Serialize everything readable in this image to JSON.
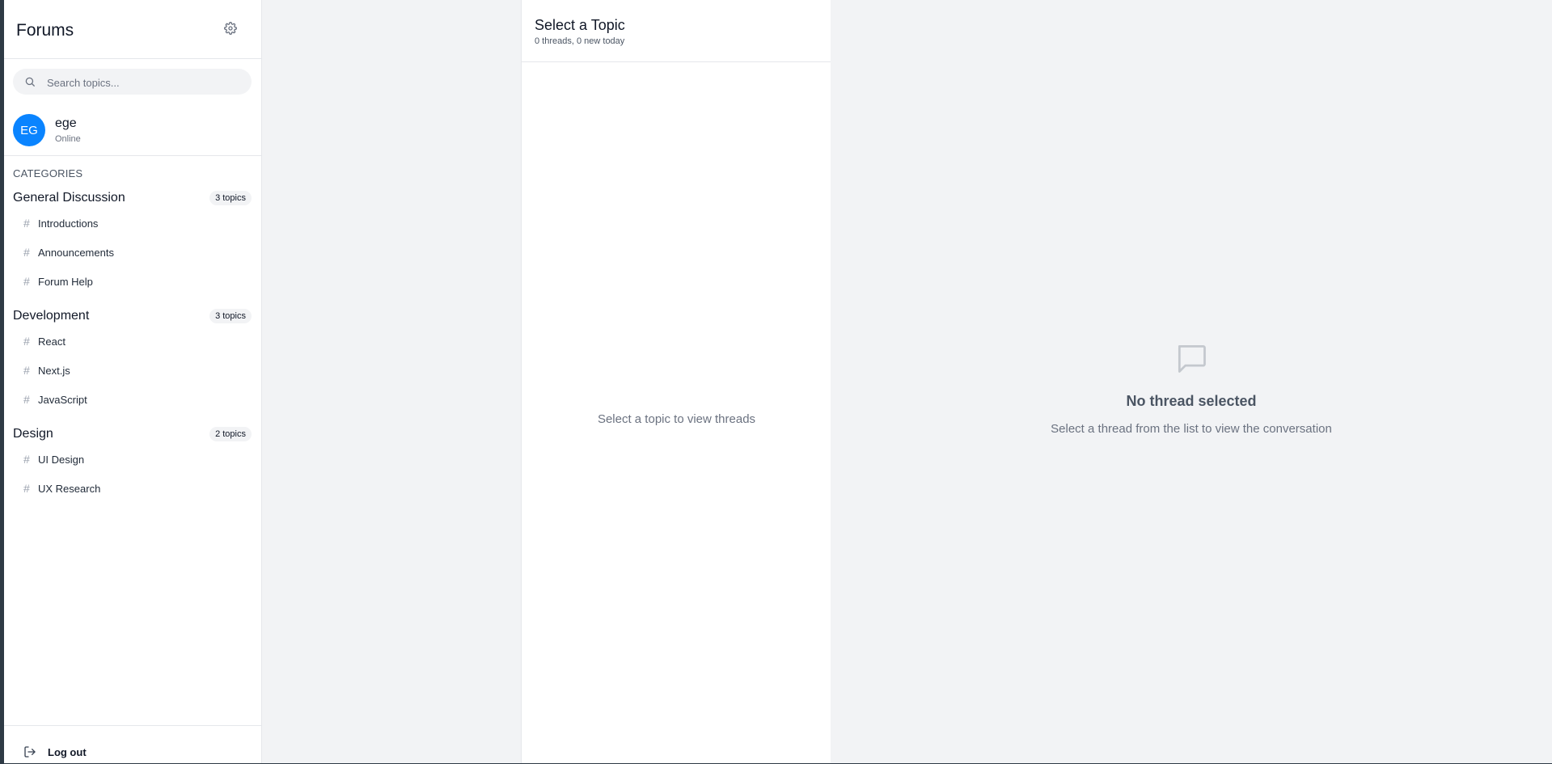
{
  "sidebar": {
    "title": "Forums",
    "search": {
      "placeholder": "Search topics..."
    },
    "user": {
      "initials": "EG",
      "name": "ege",
      "status": "Online"
    },
    "categories_heading": "CATEGORIES",
    "categories": [
      {
        "name": "General Discussion",
        "badge": "3 topics",
        "topics": [
          "Introductions",
          "Announcements",
          "Forum Help"
        ]
      },
      {
        "name": "Development",
        "badge": "3 topics",
        "topics": [
          "React",
          "Next.js",
          "JavaScript"
        ]
      },
      {
        "name": "Design",
        "badge": "2 topics",
        "topics": [
          "UI Design",
          "UX Research"
        ]
      }
    ],
    "logout_label": "Log out"
  },
  "thread_panel": {
    "title": "Select a Topic",
    "subtitle": "0 threads, 0 new today",
    "empty_message": "Select a topic to view threads"
  },
  "conversation": {
    "empty_title": "No thread selected",
    "empty_subtitle": "Select a thread from the list to view the conversation"
  },
  "colors": {
    "accent": "#0a84ff",
    "background": "#f2f3f5",
    "panel": "#ffffff"
  },
  "icons": {
    "settings": "gear-icon",
    "search": "search-icon",
    "topic": "hash-icon",
    "logout": "logout-icon",
    "empty": "message-square-icon"
  }
}
